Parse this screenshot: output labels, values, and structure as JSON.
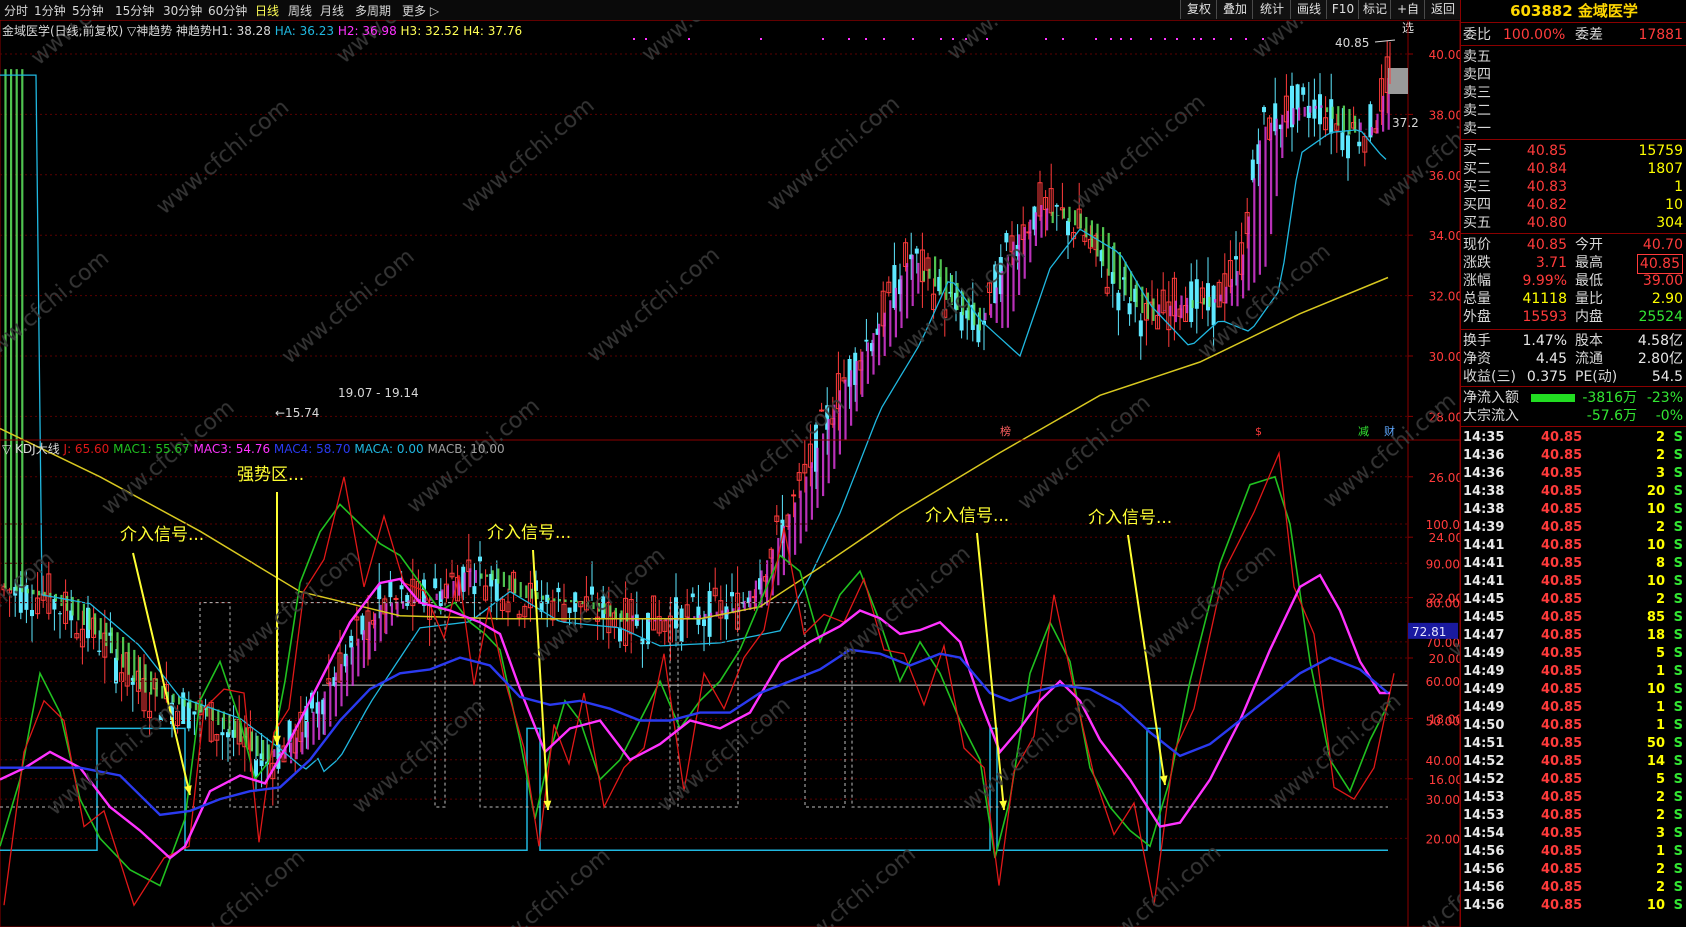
{
  "toolbar": {
    "periods": [
      "分时",
      "1分钟",
      "5分钟",
      "15分钟",
      "30分钟",
      "60分钟",
      "日线",
      "周线",
      "月线",
      "多周期",
      "更多"
    ],
    "active_period": "日线",
    "buttons": [
      "复权",
      "叠加",
      "统计",
      "画线",
      "F10",
      "标记",
      "+自选",
      "返回"
    ]
  },
  "upper_panel": {
    "title": "金域医学(日线,前复权)",
    "indicator": "▽神趋势  神趋势H1: 38.28",
    "ha": "HA: 36.23",
    "h2": "H2: 36.98",
    "h3": "H3: 32.52",
    "h4": "H4: 37.76",
    "price_axis": [
      "40.00",
      "38.00",
      "36.00",
      "34.00",
      "32.00",
      "30.00",
      "28.00",
      "26.00",
      "24.00",
      "22.00",
      "20.00",
      "18.00",
      "16.00"
    ],
    "high_mark": "40.85",
    "low_mark": "15.74",
    "mid_mark": "19.07 - 19.14",
    "right_mark": "37.2",
    "event_marks": [
      "榜",
      "$",
      "减",
      "财"
    ]
  },
  "lower_panel": {
    "title": "▽ KDJ大线",
    "j": "J: 65.60",
    "mac1": "MAC1: 55.67",
    "mac3": "MAC3: 54.76",
    "mac4": "MAC4: 58.70",
    "maca": "MACA: 0.00",
    "macb": "MACB: 10.00",
    "axis": [
      "100.0",
      "90.00",
      "80.00",
      "70.00",
      "60.00",
      "50.00",
      "40.00",
      "30.00",
      "20.00"
    ],
    "current_value": "72.81",
    "annotations": [
      "介入信号...",
      "强势区...",
      "介入信号...",
      "介入信号...",
      "介入信号..."
    ]
  },
  "watermark": "www.cfchi.com",
  "quote": {
    "code_name": "603882 金域医学",
    "weibi_label": "委比",
    "weibi": "100.00%",
    "weicha_label": "委差",
    "weicha": "17881",
    "asks": [
      {
        "label": "卖五"
      },
      {
        "label": "卖四"
      },
      {
        "label": "卖三"
      },
      {
        "label": "卖二"
      },
      {
        "label": "卖一"
      }
    ],
    "bids": [
      {
        "label": "买一",
        "price": "40.85",
        "vol": "15759"
      },
      {
        "label": "买二",
        "price": "40.84",
        "vol": "1807"
      },
      {
        "label": "买三",
        "price": "40.83",
        "vol": "1"
      },
      {
        "label": "买四",
        "price": "40.82",
        "vol": "10"
      },
      {
        "label": "买五",
        "price": "40.80",
        "vol": "304"
      }
    ],
    "stats": [
      {
        "l1": "现价",
        "v1": "40.85",
        "l2": "今开",
        "v2": "40.70"
      },
      {
        "l1": "涨跌",
        "v1": "3.71",
        "l2": "最高",
        "v2": "40.85"
      },
      {
        "l1": "涨幅",
        "v1": "9.99%",
        "l2": "最低",
        "v2": "39.00"
      },
      {
        "l1": "总量",
        "v1": "41118",
        "l2": "量比",
        "v2": "2.90"
      },
      {
        "l1": "外盘",
        "v1": "15593",
        "l2": "内盘",
        "v2": "25524"
      }
    ],
    "fin": [
      {
        "l1": "换手",
        "v1": "1.47%",
        "l2": "股本",
        "v2": "4.58亿"
      },
      {
        "l1": "净资",
        "v1": "4.45",
        "l2": "流通",
        "v2": "2.80亿"
      },
      {
        "l1": "收益(三)",
        "v1": "0.375",
        "l2": "PE(动)",
        "v2": "54.5"
      }
    ],
    "flow": [
      {
        "label": "净流入额",
        "value": "-3816万",
        "pct": "-23%"
      },
      {
        "label": "大宗流入",
        "value": "-57.6万",
        "pct": "-0%"
      }
    ],
    "ticks": [
      {
        "t": "14:35",
        "p": "40.85",
        "v": "2",
        "s": "S"
      },
      {
        "t": "14:36",
        "p": "40.85",
        "v": "2",
        "s": "S"
      },
      {
        "t": "14:36",
        "p": "40.85",
        "v": "3",
        "s": "S"
      },
      {
        "t": "14:38",
        "p": "40.85",
        "v": "20",
        "s": "S"
      },
      {
        "t": "14:38",
        "p": "40.85",
        "v": "10",
        "s": "S"
      },
      {
        "t": "14:39",
        "p": "40.85",
        "v": "2",
        "s": "S"
      },
      {
        "t": "14:41",
        "p": "40.85",
        "v": "10",
        "s": "S"
      },
      {
        "t": "14:41",
        "p": "40.85",
        "v": "8",
        "s": "S"
      },
      {
        "t": "14:41",
        "p": "40.85",
        "v": "10",
        "s": "S"
      },
      {
        "t": "14:45",
        "p": "40.85",
        "v": "2",
        "s": "S"
      },
      {
        "t": "14:45",
        "p": "40.85",
        "v": "85",
        "s": "S"
      },
      {
        "t": "14:47",
        "p": "40.85",
        "v": "18",
        "s": "S"
      },
      {
        "t": "14:49",
        "p": "40.85",
        "v": "5",
        "s": "S"
      },
      {
        "t": "14:49",
        "p": "40.85",
        "v": "1",
        "s": "S"
      },
      {
        "t": "14:49",
        "p": "40.85",
        "v": "10",
        "s": "S"
      },
      {
        "t": "14:49",
        "p": "40.85",
        "v": "1",
        "s": "S"
      },
      {
        "t": "14:50",
        "p": "40.85",
        "v": "1",
        "s": "S"
      },
      {
        "t": "14:51",
        "p": "40.85",
        "v": "50",
        "s": "S"
      },
      {
        "t": "14:52",
        "p": "40.85",
        "v": "14",
        "s": "S"
      },
      {
        "t": "14:52",
        "p": "40.85",
        "v": "5",
        "s": "S"
      },
      {
        "t": "14:53",
        "p": "40.85",
        "v": "2",
        "s": "S"
      },
      {
        "t": "14:53",
        "p": "40.85",
        "v": "2",
        "s": "S"
      },
      {
        "t": "14:54",
        "p": "40.85",
        "v": "3",
        "s": "S"
      },
      {
        "t": "14:56",
        "p": "40.85",
        "v": "1",
        "s": "S"
      },
      {
        "t": "14:56",
        "p": "40.85",
        "v": "2",
        "s": "S"
      },
      {
        "t": "14:56",
        "p": "40.85",
        "v": "2",
        "s": "S"
      },
      {
        "t": "14:56",
        "p": "40.85",
        "v": "10",
        "s": "S"
      }
    ]
  },
  "colors": {
    "up": "#ff3b3b",
    "down": "#33e633",
    "magenta_bar": "#d93ad9",
    "green_bar": "#5ee65e",
    "ma_cyan": "#20b8e0",
    "ma_yellow": "#d8c820",
    "kdj_red": "#e01818",
    "kdj_green": "#20c020",
    "kdj_magenta": "#ff33ff",
    "kdj_blue": "#2a3af0",
    "step_cyan": "#20b8e0",
    "arrow": "#ffff33"
  }
}
